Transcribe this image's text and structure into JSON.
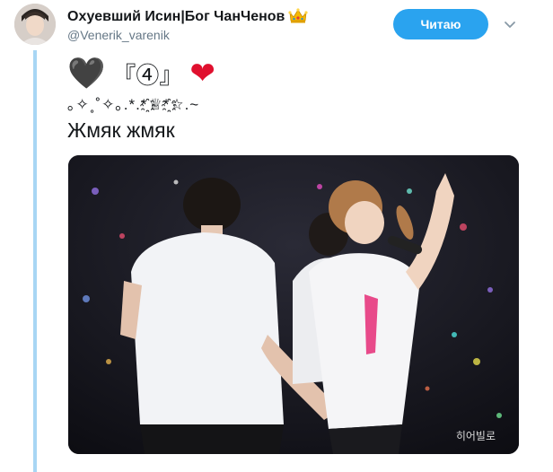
{
  "tweet": {
    "display_name": "Охуевший Исин|Бог ЧанЧенов",
    "handle": "@Venerik_varenik",
    "follow_label": "Читаю",
    "emoji_line": {
      "heart_dark": "🖤",
      "quote_number": "『④』",
      "heart_red": "❤"
    },
    "sparkle_line": "｡✧˳˚✧｡.*.*҈♕*҈☆.~",
    "text": "Жмяк жмяк",
    "photo": {
      "watermark": "히어빌로"
    }
  },
  "colors": {
    "follow_button": "#2aa3ef",
    "thread_line": "#a8d6f4",
    "heart_red": "#e0102e"
  },
  "icons": [
    "avatar",
    "crown-icon",
    "chevron-down-icon"
  ]
}
